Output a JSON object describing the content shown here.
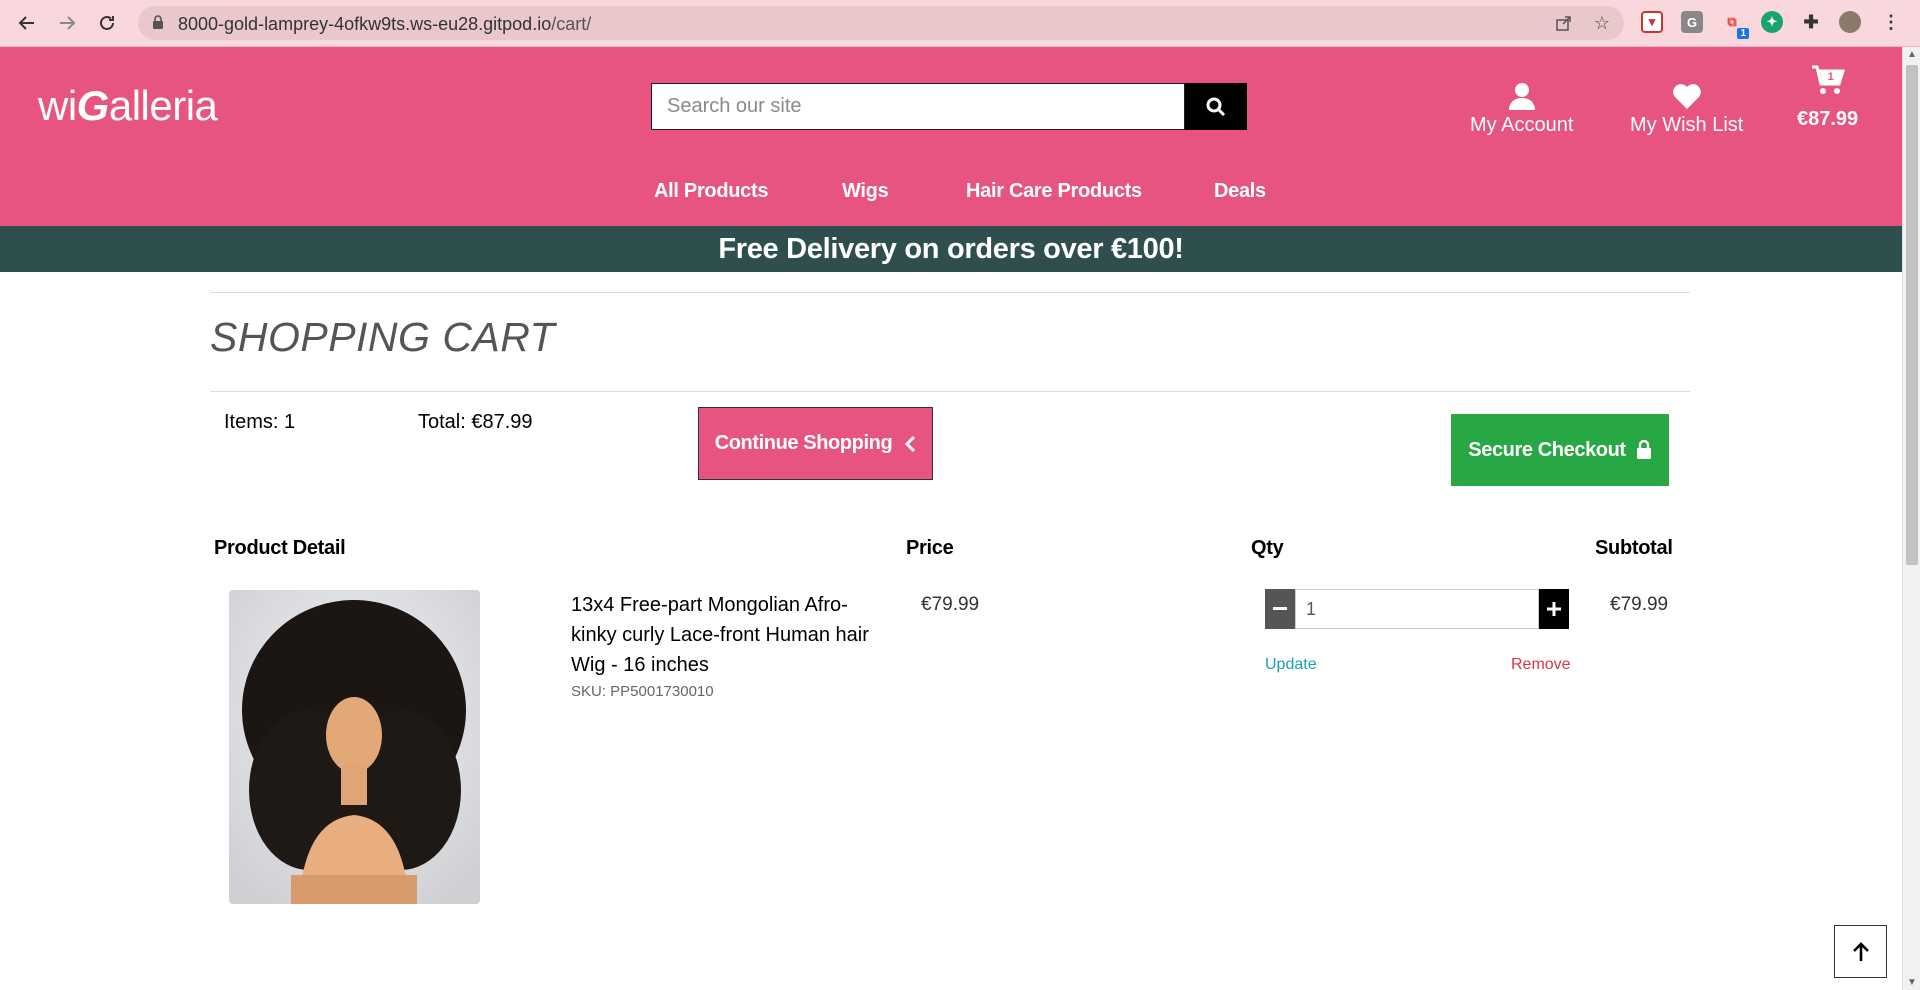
{
  "browser": {
    "url_host": "8000-gold-lamprey-4ofkw9ts.ws-eu28.gitpod.io",
    "url_path": "/cart/",
    "extension_badge": "1",
    "icons": [
      "back-icon",
      "forward-icon",
      "reload-icon",
      "lock-icon",
      "share-icon",
      "star-icon",
      "puzzle-icon",
      "avatar",
      "menu-icon"
    ]
  },
  "header": {
    "logo_pre": "wi",
    "logo_g": "G",
    "logo_post": "alleria",
    "search_placeholder": "Search our site",
    "account_label": "My Account",
    "wishlist_label": "My Wish List",
    "cart_total": "€87.99",
    "cart_count": "1",
    "brand_color": "#e75480"
  },
  "nav": {
    "items": [
      "All Products",
      "Wigs",
      "Hair Care Products",
      "Deals"
    ]
  },
  "banner": {
    "text": "Free Delivery on orders over €100!",
    "color": "#2f4f4f"
  },
  "cart": {
    "title": "SHOPPING CART",
    "items_text": "Items: 1",
    "total_text": "Total: €87.99",
    "continue_label": "Continue Shopping",
    "checkout_label": "Secure Checkout",
    "checkout_color": "#28a745",
    "columns": [
      "Product Detail",
      "Price",
      "Qty",
      "Subtotal"
    ],
    "line_items": [
      {
        "name": "13x4 Free-part Mongolian Afro-kinky curly Lace-front Human hair Wig - 16 inches",
        "sku": "SKU: PP5001730010",
        "price": "€79.99",
        "qty": "1",
        "subtotal": "€79.99",
        "update_label": "Update",
        "remove_label": "Remove"
      }
    ]
  }
}
